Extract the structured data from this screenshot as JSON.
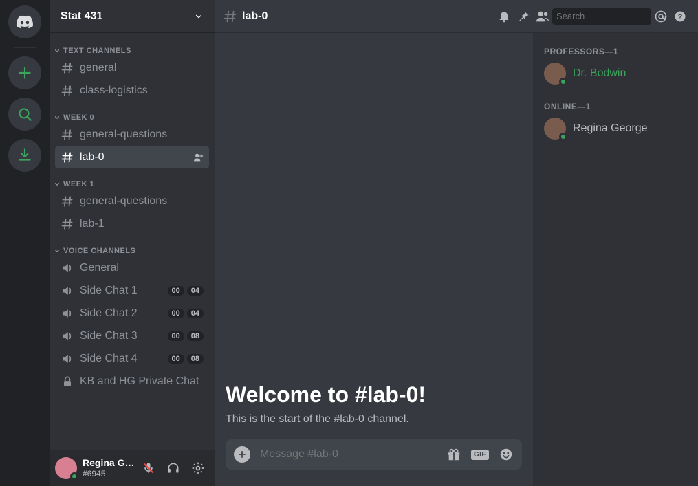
{
  "server": {
    "name": "Stat 431"
  },
  "categories": [
    {
      "name": "TEXT CHANNELS",
      "channels": [
        {
          "label": "general",
          "type": "text"
        },
        {
          "label": "class-logistics",
          "type": "text"
        }
      ]
    },
    {
      "name": "WEEK 0",
      "channels": [
        {
          "label": "general-questions",
          "type": "text"
        },
        {
          "label": "lab-0",
          "type": "text",
          "selected": true
        }
      ]
    },
    {
      "name": "WEEK 1",
      "channels": [
        {
          "label": "general-questions",
          "type": "text"
        },
        {
          "label": "lab-1",
          "type": "text"
        }
      ]
    },
    {
      "name": "VOICE CHANNELS",
      "channels": [
        {
          "label": "General",
          "type": "voice"
        },
        {
          "label": "Side Chat 1",
          "type": "voice",
          "badges": [
            "00",
            "04"
          ]
        },
        {
          "label": "Side Chat 2",
          "type": "voice",
          "badges": [
            "00",
            "04"
          ]
        },
        {
          "label": "Side Chat 3",
          "type": "voice",
          "badges": [
            "00",
            "08"
          ]
        },
        {
          "label": "Side Chat 4",
          "type": "voice",
          "badges": [
            "00",
            "08"
          ]
        },
        {
          "label": "KB and HG Private Chat",
          "type": "voice-locked"
        }
      ]
    }
  ],
  "user": {
    "name": "Regina Geor...",
    "tag": "#6945"
  },
  "topbar": {
    "channel": "lab-0",
    "search_placeholder": "Search"
  },
  "composer": {
    "placeholder": "Message #lab-0",
    "gif_label": "GIF"
  },
  "welcome": {
    "title": "Welcome to #lab-0!",
    "subtitle": "This is the start of the #lab-0 channel."
  },
  "member_groups": [
    {
      "header": "PROFESSORS—1",
      "members": [
        {
          "name": "Dr. Bodwin",
          "color": "#3ba55d"
        }
      ]
    },
    {
      "header": "ONLINE—1",
      "members": [
        {
          "name": "Regina George",
          "color": "#b9bbbe"
        }
      ]
    }
  ]
}
